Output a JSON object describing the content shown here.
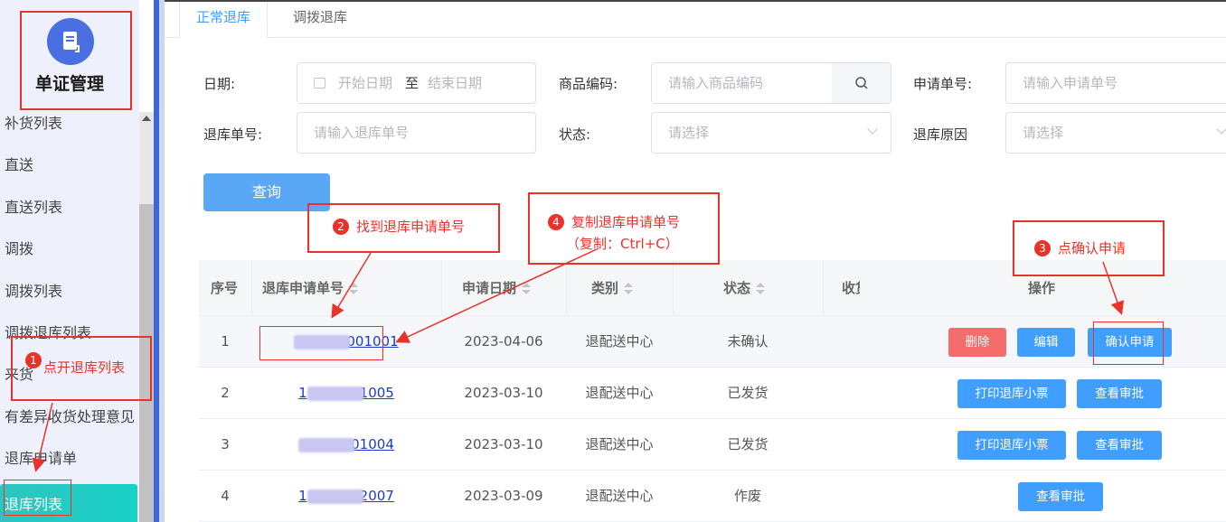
{
  "sidebar": {
    "module_title": "单证管理",
    "menu": [
      {
        "label": "补货列表"
      },
      {
        "label": "直送"
      },
      {
        "label": "直送列表"
      },
      {
        "label": "调拨"
      },
      {
        "label": "调拨列表"
      },
      {
        "label": "调拨退库列表"
      },
      {
        "label": "来货"
      },
      {
        "label": "有差异收货处理意见"
      },
      {
        "label": "退库申请单"
      },
      {
        "label": "退库列表"
      }
    ]
  },
  "tabs": [
    {
      "label": "正常退库"
    },
    {
      "label": "调拨退库"
    }
  ],
  "filters": {
    "date_label": "日期:",
    "date_start_placeholder": "开始日期",
    "date_to": "至",
    "date_end_placeholder": "结束日期",
    "sku_label": "商品编码:",
    "sku_placeholder": "请输入商品编码",
    "apply_no_label": "申请单号:",
    "apply_no_placeholder": "请输入申请单号",
    "return_no_label": "退库单号:",
    "return_no_placeholder": "请输入退库单号",
    "status_label": "状态:",
    "status_placeholder": "请选择",
    "reason_label": "退库原因",
    "reason_placeholder": "请选择",
    "query_button": "查询"
  },
  "table": {
    "headers": {
      "index": "序号",
      "apply_no": "退库申请单号",
      "apply_date": "申请日期",
      "category": "类别",
      "status": "状态",
      "receive": "收货",
      "actions": "操作"
    },
    "rows": [
      {
        "index": "1",
        "apply_no_prefix": "",
        "apply_no_suffix": "001001",
        "date": "2023-04-06",
        "category": "退配送中心",
        "status": "未确认"
      },
      {
        "index": "2",
        "apply_no_prefix": "1",
        "apply_no_suffix": "1005",
        "date": "2023-03-10",
        "category": "退配送中心",
        "status": "已发货"
      },
      {
        "index": "3",
        "apply_no_prefix": "",
        "apply_no_suffix": "01004",
        "date": "2023-03-10",
        "category": "退配送中心",
        "status": "已发货"
      },
      {
        "index": "4",
        "apply_no_prefix": "1",
        "apply_no_suffix": "2007",
        "date": "2023-03-09",
        "category": "退配送中心",
        "status": "作废"
      }
    ],
    "action_labels": {
      "delete": "删除",
      "edit": "编辑",
      "confirm": "确认申请",
      "print": "打印退库小票",
      "view": "查看审批"
    }
  },
  "annotations": {
    "step1": {
      "num": "1",
      "text": "点开退库列表"
    },
    "step2": {
      "num": "2",
      "text": "找到退库申请单号"
    },
    "step3": {
      "num": "3",
      "text": "点确认申请"
    },
    "step4": {
      "num": "4",
      "text": "复制退库申请单号",
      "subtext": "（复制：Ctrl+C）"
    }
  },
  "colors": {
    "accent": "#409eff",
    "active_menu": "#19d2c6",
    "danger": "#f56c6c",
    "annotation": "#e8332b",
    "sidebar_rail": "#3f66d6"
  }
}
